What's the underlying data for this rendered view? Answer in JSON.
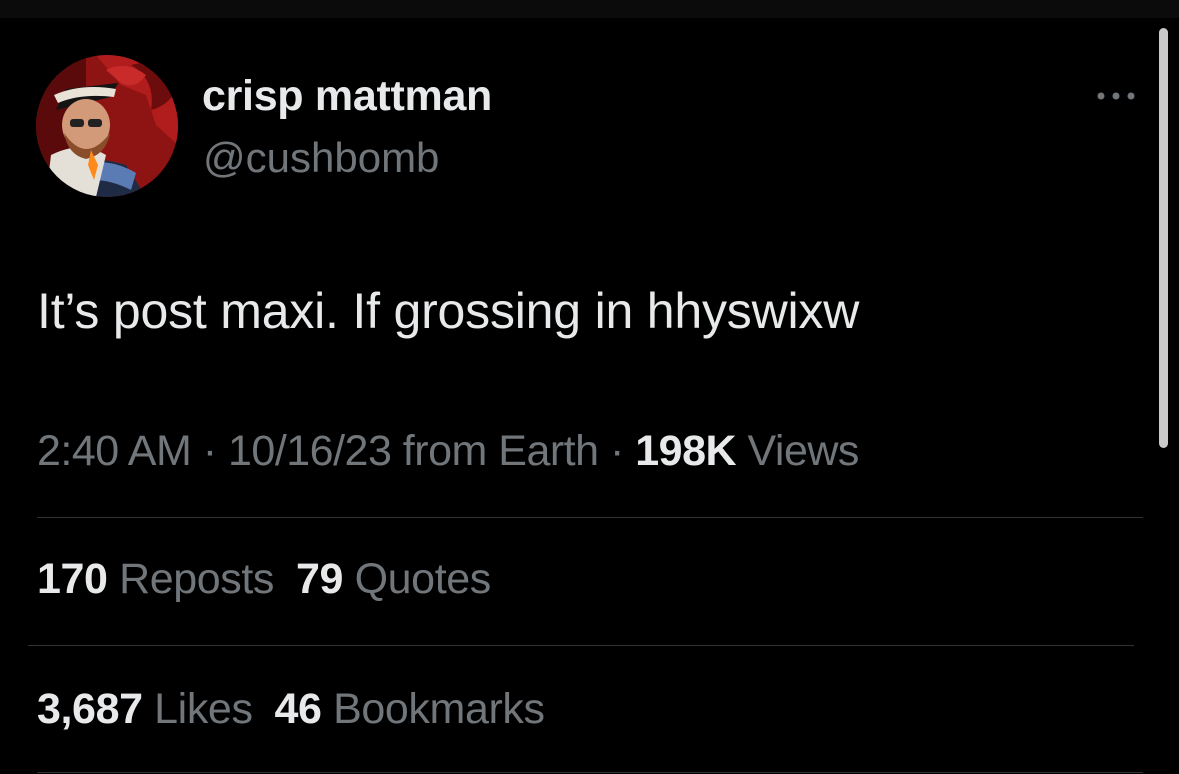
{
  "user": {
    "display_name": "crisp mattman",
    "handle": "@cushbomb"
  },
  "tweet": {
    "text": "It’s post maxi. If grossing in hhyswixw"
  },
  "meta": {
    "time": "2:40 AM",
    "separator1": " · ",
    "date_source": "10/16/23 from Earth",
    "separator2": " · ",
    "views_count": "198K",
    "views_label": " Views"
  },
  "stats": {
    "reposts_count": "170",
    "reposts_label": " Reposts",
    "quotes_count": "79",
    "quotes_label": " Quotes",
    "likes_count": "3,687",
    "likes_label": " Likes",
    "bookmarks_count": "46",
    "bookmarks_label": " Bookmarks"
  },
  "icons": {
    "more": "more-horizontal-icon"
  },
  "colors": {
    "background": "#000000",
    "primary_text": "#e7e9ea",
    "secondary_text": "#71767b",
    "divider": "#2f3336"
  }
}
